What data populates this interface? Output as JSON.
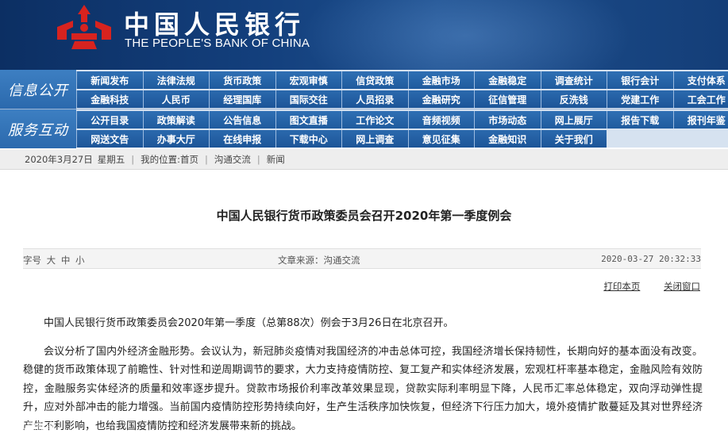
{
  "header": {
    "title_cn": "中国人民银行",
    "title_en": "THE PEOPLE'S BANK OF CHINA",
    "logo_icon": "pboc-emblem-icon",
    "colors": {
      "banner": "#143e78",
      "nav": "#1f5b9e",
      "logo": "#d7231f"
    }
  },
  "nav": {
    "section1": {
      "label": "信息公开",
      "row1": [
        "新闻发布",
        "法律法规",
        "货币政策",
        "宏观审慎",
        "信贷政策",
        "金融市场",
        "金融稳定",
        "调查统计",
        "银行会计",
        "支付体系"
      ],
      "row2": [
        "金融科技",
        "人民币",
        "经理国库",
        "国际交往",
        "人员招录",
        "金融研究",
        "征信管理",
        "反洗钱",
        "党建工作",
        "工会工作"
      ]
    },
    "section2": {
      "label": "服务互动",
      "row1": [
        "公开目录",
        "政策解读",
        "公告信息",
        "图文直播",
        "工作论文",
        "音频视频",
        "市场动态",
        "网上展厅",
        "报告下载",
        "报刊年鉴"
      ],
      "row2": [
        "网送文告",
        "办事大厅",
        "在线申报",
        "下载中心",
        "网上调查",
        "意见征集",
        "金融知识",
        "关于我们"
      ]
    }
  },
  "breadcrumb": {
    "date": "2020年3月27日",
    "weekday": "星期五",
    "location_label": "我的位置:",
    "home": "首页",
    "level1": "沟通交流",
    "level2": "新闻"
  },
  "article": {
    "title": "中国人民银行货币政策委员会召开2020年第一季度例会",
    "fontsize_label": "字号",
    "fontsize_options": [
      "大",
      "中",
      "小"
    ],
    "source": "文章来源：沟通交流",
    "timestamp": "2020-03-27 20:32:33",
    "print_label": "打印本页",
    "close_label": "关闭窗口",
    "paragraphs": [
      "中国人民银行货币政策委员会2020年第一季度（总第88次）例会于3月26日在北京召开。",
      "会议分析了国内外经济金融形势。会议认为，新冠肺炎疫情对我国经济的冲击总体可控，我国经济增长保持韧性，长期向好的基本面没有改变。稳健的货币政策体现了前瞻性、针对性和逆周期调节的要求，大力支持疫情防控、复工复产和实体经济发展，宏观杠杆率基本稳定，金融风险有效防控，金融服务实体经济的质量和效率逐步提升。贷款市场报价利率改革效果显现，贷款实际利率明显下降，人民币汇率总体稳定，双向浮动弹性提升，应对外部冲击的能力增强。当前国内疫情防控形势持续向好，生产生活秩序加快恢复，但经济下行压力加大，境外疫情扩散蔓延及其对世界经济产生不利影响，也给我国疫情防控和经济发展带来新的挑战。"
    ]
  },
  "watermark": "CO 大数据库"
}
